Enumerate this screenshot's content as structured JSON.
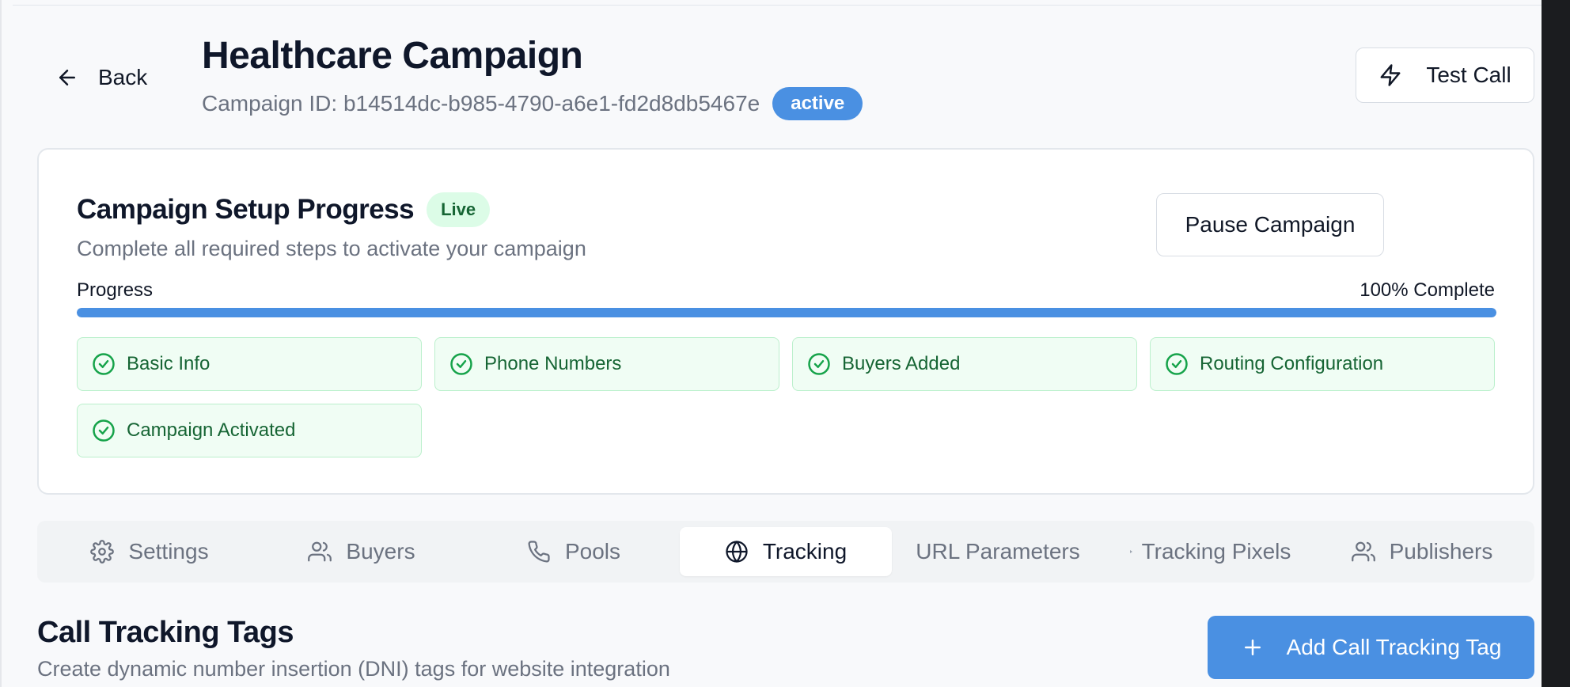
{
  "header": {
    "back_label": "Back",
    "title": "Healthcare Campaign",
    "campaign_id_text": "Campaign ID: b14514dc-b985-4790-a6e1-fd2d8db5467e",
    "status": "active",
    "test_call_label": "Test Call"
  },
  "progress_card": {
    "title": "Campaign Setup Progress",
    "badge": "Live",
    "subtitle": "Complete all required steps to activate your campaign",
    "pause_label": "Pause Campaign",
    "progress_label": "Progress",
    "progress_value_text": "100% Complete",
    "progress_percent": 100,
    "steps": [
      {
        "label": "Basic Info",
        "icon": "check-circle-icon"
      },
      {
        "label": "Phone Numbers",
        "icon": "check-circle-icon"
      },
      {
        "label": "Buyers Added",
        "icon": "check-circle-icon"
      },
      {
        "label": "Routing Configuration",
        "icon": "check-circle-icon"
      },
      {
        "label": "Campaign Activated",
        "icon": "check-circle-icon"
      }
    ]
  },
  "tabs": [
    {
      "label": "Settings",
      "icon": "gear-icon",
      "active": false
    },
    {
      "label": "Buyers",
      "icon": "users-icon",
      "active": false
    },
    {
      "label": "Pools",
      "icon": "phone-icon",
      "active": false
    },
    {
      "label": "Tracking",
      "icon": "globe-icon",
      "active": true
    },
    {
      "label": "URL Parameters",
      "icon": "",
      "active": false
    },
    {
      "label": "Tracking Pixels",
      "icon": "dot-icon",
      "active": false
    },
    {
      "label": "Publishers",
      "icon": "users-icon",
      "active": false
    }
  ],
  "section": {
    "title": "Call Tracking Tags",
    "subtitle": "Create dynamic number insertion (DNI) tags for website integration",
    "add_button_label": "Add Call Tracking Tag"
  },
  "colors": {
    "accent": "#4a90e2",
    "success_text": "#166534",
    "success_bg": "#f0fdf4",
    "success_border": "#bbf0cc"
  }
}
